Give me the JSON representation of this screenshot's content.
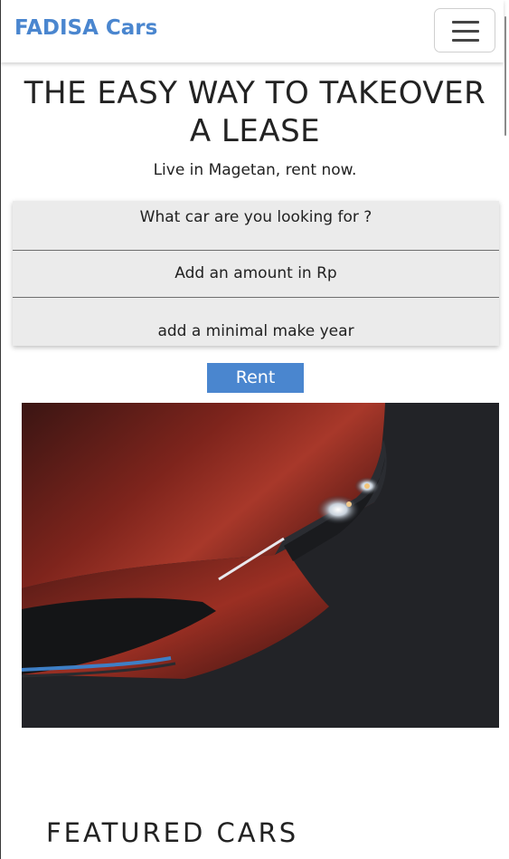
{
  "navbar": {
    "brand": "FADISA Cars",
    "toggler_icon": "hamburger-menu-icon"
  },
  "hero": {
    "title": "THE EASY WAY TO TAKEOVER A LEASE",
    "subtitle": "Live in Magetan, rent now."
  },
  "search": {
    "car_placeholder": "What car are you looking for ?",
    "amount_placeholder": "Add an amount in Rp",
    "year_placeholder": "add a minimal make year",
    "submit_label": "Rent"
  },
  "featured": {
    "title": "FEATURED CARS"
  },
  "colors": {
    "brand": "#4a86cf",
    "button": "#4a86cf",
    "form_bg": "#ebebeb",
    "text": "#222222",
    "car_red": "#9c2e22"
  }
}
